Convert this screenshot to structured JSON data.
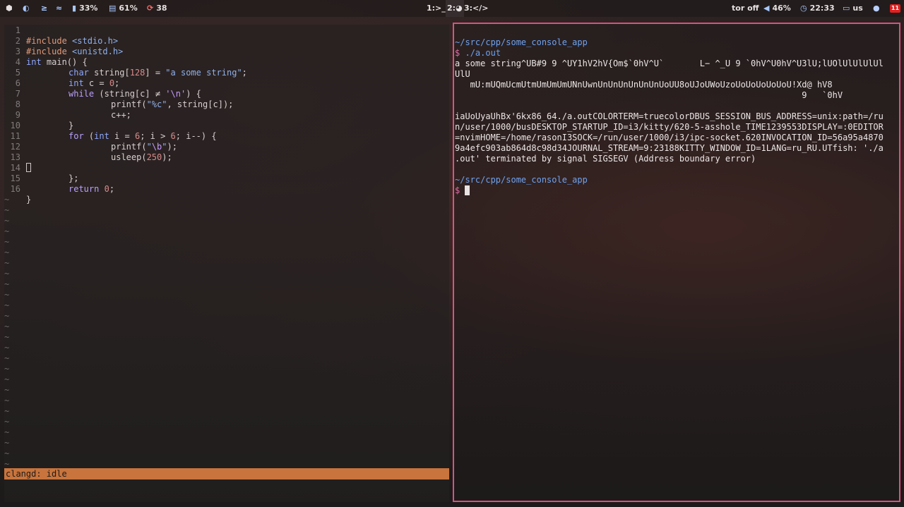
{
  "topbar": {
    "cpu_pct": "33%",
    "mem_pct": "61%",
    "updates": "38",
    "workspaces": [
      {
        "label": "1:>_"
      },
      {
        "label": "2:"
      },
      {
        "label": "3:</>"
      }
    ],
    "tor": "tor off",
    "volume": "46%",
    "time": "22:33",
    "layout": "us",
    "notif_count": "11"
  },
  "editor": {
    "lines": [
      {
        "n": "1"
      },
      {
        "n": "2"
      },
      {
        "n": "3"
      },
      {
        "n": "4"
      },
      {
        "n": "5"
      },
      {
        "n": "6"
      },
      {
        "n": "7"
      },
      {
        "n": "8"
      },
      {
        "n": "9"
      },
      {
        "n": "10"
      },
      {
        "n": "11"
      },
      {
        "n": "12"
      },
      {
        "n": "13"
      },
      {
        "n": "14"
      },
      {
        "n": "15"
      },
      {
        "n": "16"
      }
    ],
    "code": {
      "l1_pp": "#include",
      "l1_inc": " <stdio.h>",
      "l2_pp": "#include",
      "l2_inc": " <unistd.h>",
      "l3_ty": "int",
      "l3_rest": " main() {",
      "l4_ty": "char",
      "l4_a": " string[",
      "l4_num": "128",
      "l4_b": "] = ",
      "l4_str": "\"a some string\"",
      "l4_c": ";",
      "l5_ty": "int",
      "l5_a": " c = ",
      "l5_num": "0",
      "l5_b": ";",
      "l6_kw": "while",
      "l6_a": " (string[c] ≠ ",
      "l6_str": "'\\n'",
      "l6_b": ") {",
      "l7_fn": "printf(",
      "l7_str": "\"%c\"",
      "l7_b": ", string[c]);",
      "l8": "c++;",
      "l9": "}",
      "l10_kw": "for",
      "l10_a": " (",
      "l10_ty": "int",
      "l10_b": " i = ",
      "l10_n1": "6",
      "l10_c": "; i > ",
      "l10_n2": "6",
      "l10_d": "; i--) {",
      "l11_fn": "printf(",
      "l11_str1": "\"",
      "l11_esc": "\\b",
      "l11_str2": "\"",
      "l11_b": ");",
      "l12_fn": "usleep(",
      "l12_num": "250",
      "l12_b": ");",
      "l14": "};",
      "l15_kw": "return",
      "l15_sp": " ",
      "l15_num": "0",
      "l15_b": ";",
      "l16": "}"
    },
    "tilde": "~",
    "status": "clangd: idle"
  },
  "terminal": {
    "cwd1": "~/src/cpp/some_console_app",
    "prompt1": "$",
    "cmd1": "./a.out",
    "out": [
      "a some string^UB#9 9 ^UY1hV2hV{Om$`0hV^U`       L− ^_U 9 `0hV^U0hV^U3lU;lUOlUlUlUlUl",
      "UlU",
      "   mU:mUQmUcmUtmUmUmUmUNnUwnUnUnUnUnUnUnUoUU8oUJoUWoUzoUoUoUoUoUoU!Xd@ hV8",
      "                                                                    9   `0hV",
      "",
      "iaUoUyaUhBx'6kx86_64./a.outCOLORTERM=truecolorDBUS_SESSION_BUS_ADDRESS=unix:path=/ru",
      "n/user/1000/busDESKTOP_STARTUP_ID=i3/kitty/620-5-asshole_TIME1239553DISPLAY=:0EDITOR",
      "=nvimHOME=/home/rasonI3SOCK=/run/user/1000/i3/ipc-socket.620INVOCATION_ID=56a95a4870",
      "9a4efc903ab864d8c98d34JOURNAL_STREAM=9:23188KITTY_WINDOW_ID=1LANG=ru_RU.UTfish: './a",
      ".out' terminated by signal SIGSEGV (Address boundary error)"
    ],
    "cwd2": "~/src/cpp/some_console_app",
    "prompt2": "$"
  },
  "colors": {
    "accent_border": "#d9527f",
    "statusline": "#c8743c"
  }
}
